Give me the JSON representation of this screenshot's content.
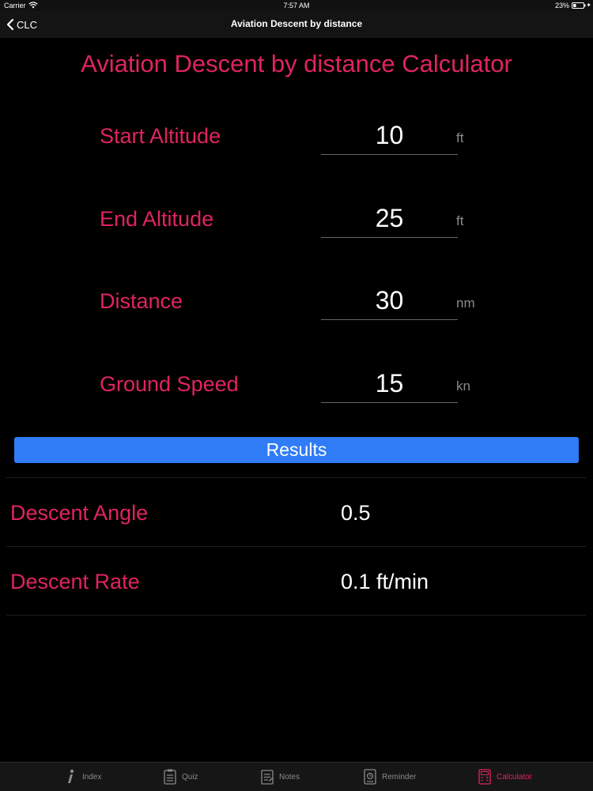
{
  "status_bar": {
    "carrier": "Carrier",
    "time": "7:57 AM",
    "battery": "23%",
    "wifi_icon": "wifi-icon",
    "battery_icon": "battery-icon",
    "charging_icon": "charging-icon"
  },
  "nav": {
    "back_label": "CLC",
    "title": "Aviation Descent by distance"
  },
  "main": {
    "title": "Aviation Descent by distance Calculator",
    "fields": [
      {
        "label": "Start Altitude",
        "value": "10",
        "unit": "ft"
      },
      {
        "label": "End Altitude",
        "value": "25",
        "unit": "ft"
      },
      {
        "label": "Distance",
        "value": "30",
        "unit": "nm"
      },
      {
        "label": "Ground Speed",
        "value": "15",
        "unit": "kn"
      }
    ],
    "results_button": "Results",
    "results": [
      {
        "label": "Descent Angle",
        "value": "0.5"
      },
      {
        "label": "Descent Rate",
        "value": "0.1 ft/min"
      }
    ]
  },
  "tabs": [
    {
      "label": "Index",
      "icon": "info-icon",
      "active": false
    },
    {
      "label": "Quiz",
      "icon": "quiz-icon",
      "active": false
    },
    {
      "label": "Notes",
      "icon": "notes-icon",
      "active": false
    },
    {
      "label": "Reminder",
      "icon": "reminder-icon",
      "active": false
    },
    {
      "label": "Calculator",
      "icon": "calculator-icon",
      "active": true
    }
  ],
  "colors": {
    "accent": "#e0245e",
    "button": "#2f7cf6",
    "background": "#000000"
  }
}
